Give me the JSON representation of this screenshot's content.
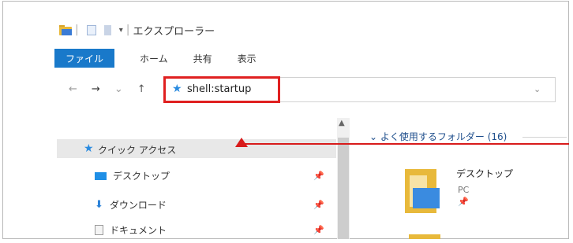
{
  "window": {
    "title": "エクスプローラー"
  },
  "ribbon": {
    "tabs": [
      "ファイル",
      "ホーム",
      "共有",
      "表示"
    ]
  },
  "nav": {
    "back": "←",
    "forward": "→",
    "recent": "⌄",
    "up": "↑"
  },
  "address": {
    "value": "shell:startup",
    "dropdown": "⌄"
  },
  "left_pane": {
    "quick_access": "クイック アクセス",
    "items": [
      {
        "label": "デスクトップ",
        "icon": "desktop-icon",
        "pinned": true
      },
      {
        "label": "ダウンロード",
        "icon": "download-icon",
        "pinned": true
      },
      {
        "label": "ドキュメント",
        "icon": "document-icon",
        "pinned": true
      }
    ]
  },
  "right_pane": {
    "group_header": "よく使用するフォルダー (16)",
    "tiles": [
      {
        "name": "デスクトップ",
        "location": "PC"
      }
    ]
  },
  "annotation": {
    "color": "#e02020"
  }
}
